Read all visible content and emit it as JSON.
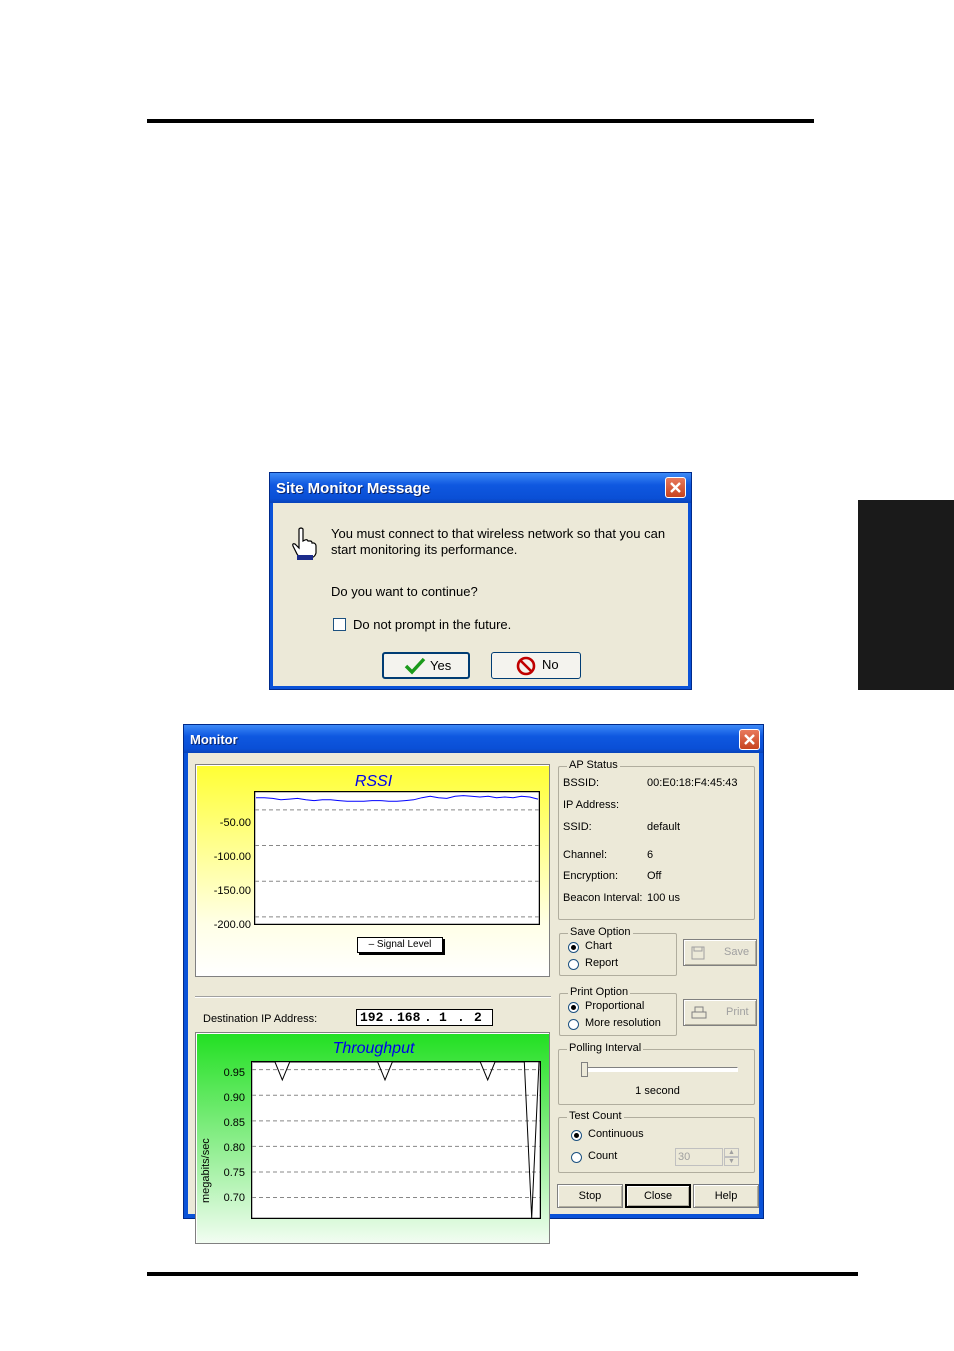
{
  "dialog": {
    "title": "Site Monitor Message",
    "message_line1": "You must connect to that wireless network so that you can",
    "message_line2": "start monitoring its performance.",
    "question": "Do you want to continue?",
    "checkbox_label": "Do not prompt in the future.",
    "yes_label": "Yes",
    "no_label": "No"
  },
  "monitor": {
    "title": "Monitor",
    "rssi": {
      "title": "RSSI",
      "legend": "– Signal Level",
      "y_ticks": [
        "-50.00",
        "-100.00",
        "-150.00",
        "-200.00"
      ]
    },
    "destination": {
      "label": "Destination IP Address:",
      "ip1": "192",
      "ip2": "168",
      "ip3": "1",
      "ip4": "2"
    },
    "throughput": {
      "title": "Throughput",
      "ylabel": "megabits/sec",
      "y_ticks": [
        "0.95",
        "0.90",
        "0.85",
        "0.80",
        "0.75",
        "0.70"
      ]
    },
    "ap_status": {
      "group_label": "AP Status",
      "bssid_label": "BSSID:",
      "bssid": "00:E0:18:F4:45:43",
      "ip_label": "IP Address:",
      "ip": "",
      "ssid_label": "SSID:",
      "ssid": "default",
      "channel_label": "Channel:",
      "channel": "6",
      "encryption_label": "Encryption:",
      "encryption": "Off",
      "beacon_label": "Beacon Interval:",
      "beacon": "100 us"
    },
    "save_option": {
      "group_label": "Save Option",
      "opt_chart": "Chart",
      "opt_report": "Report",
      "selected": "Chart",
      "button": "Save"
    },
    "print_option": {
      "group_label": "Print Option",
      "opt_proportional": "Proportional",
      "opt_more": "More resolution",
      "selected": "Proportional",
      "button": "Print"
    },
    "polling": {
      "group_label": "Polling Interval",
      "value": "1 second"
    },
    "test_count": {
      "group_label": "Test Count",
      "opt_continuous": "Continuous",
      "opt_count": "Count",
      "selected": "Continuous",
      "count_value": "30"
    },
    "buttons": {
      "stop": "Stop",
      "close": "Close",
      "help": "Help"
    }
  },
  "chart_data": [
    {
      "type": "line",
      "title": "RSSI",
      "ylabel": "",
      "ylim": [
        -210,
        -25
      ],
      "series": [
        {
          "name": "Signal Level",
          "color": "#0000ff",
          "values": [
            -33,
            -33,
            -34,
            -36,
            -35,
            -34,
            -36,
            -37,
            -36,
            -36,
            -37,
            -38,
            -38,
            -38,
            -37,
            -37,
            -38,
            -38,
            -37,
            -36,
            -33,
            -31,
            -33,
            -34,
            -31,
            -30,
            -31,
            -32,
            -31,
            -33,
            -32,
            -33,
            -31,
            -32,
            -35
          ]
        }
      ]
    },
    {
      "type": "line",
      "title": "Throughput",
      "ylabel": "megabits/sec",
      "ylim": [
        0.66,
        0.965
      ],
      "series": [
        {
          "color": "#000000",
          "values": [
            0.965,
            0.965,
            0.965,
            0.965,
            0.93,
            0.965,
            0.965,
            0.965,
            0.965,
            0.965,
            0.965,
            0.965,
            0.965,
            0.965,
            0.965,
            0.965,
            0.965,
            0.965,
            0.93,
            0.965,
            0.965,
            0.965,
            0.965,
            0.965,
            0.965,
            0.965,
            0.965,
            0.965,
            0.965,
            0.965,
            0.965,
            0.965,
            0.93,
            0.965,
            0.965,
            0.965,
            0.965,
            0.965,
            0.66,
            0.965
          ]
        }
      ]
    }
  ]
}
